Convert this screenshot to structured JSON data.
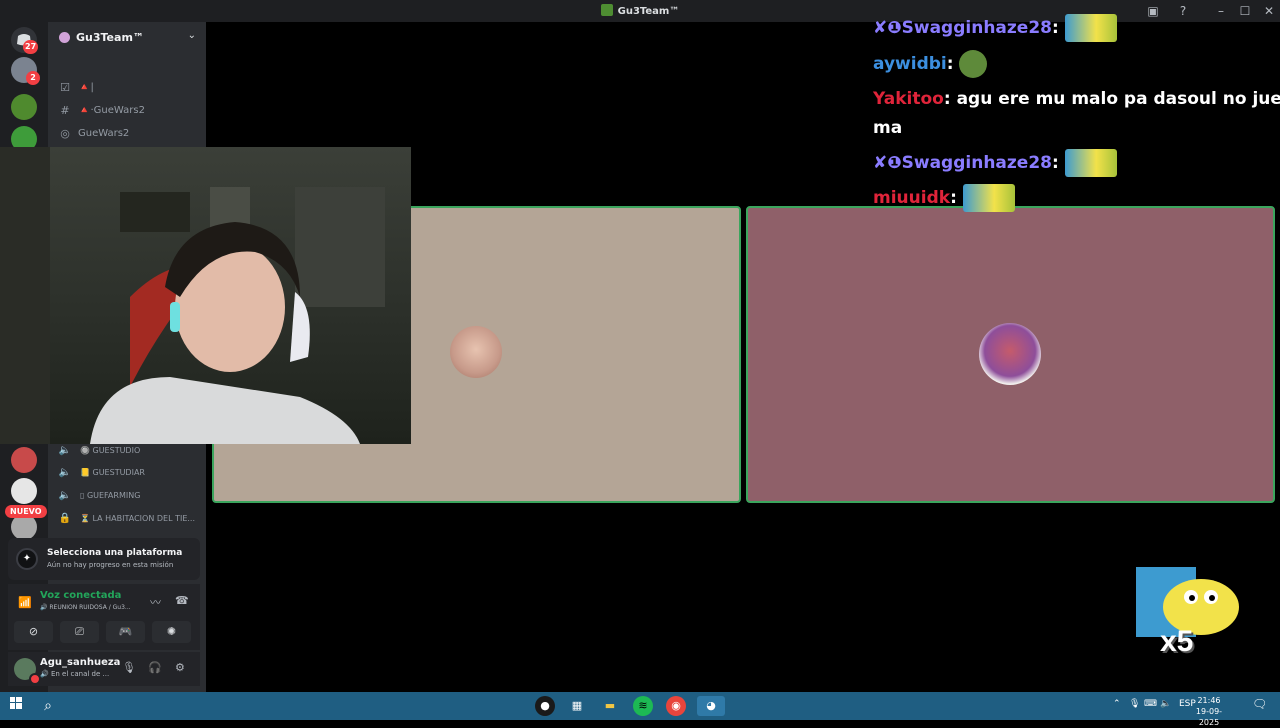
{
  "window": {
    "title": "Gu3Team™",
    "buttons": {
      "minimize": "–",
      "maximize": "☐",
      "close": "✕"
    }
  },
  "server_rail": {
    "badges": {
      "home": "27",
      "dm1": "2"
    },
    "new_label": "NUEVO"
  },
  "sidebar": {
    "server_name": "Gu3Team™",
    "channels": [
      {
        "icon": "checkbox-icon",
        "label": "🔺|"
      },
      {
        "icon": "hash-icon",
        "label": "🔺·GueWars2"
      },
      {
        "icon": "stage-icon",
        "label": "GueWars2"
      }
    ],
    "voice_channels": [
      {
        "icon": "speaker-icon",
        "label": "🔘 GUESTUDIO"
      },
      {
        "icon": "speaker-icon",
        "label": "📒 GUESTUDIAR"
      },
      {
        "icon": "speaker-icon",
        "label": "▯ GUEFARMING"
      },
      {
        "icon": "lock-icon",
        "label": "⏳ LA HABITACION DEL TIE..."
      }
    ]
  },
  "quest": {
    "title": "Selecciona una plataforma",
    "subtitle": "Aún no hay progreso en esta misión"
  },
  "voice": {
    "status": "Voz conectada",
    "detail": "🔊 REUNION RUIDOSA / Gu3..."
  },
  "user": {
    "name": "Agu_sanhueza",
    "status": "🔊 En el canal de ..."
  },
  "chat": [
    {
      "user": "✘❶Swagginhaze28",
      "color": "#8a7cff",
      "text": ""
    },
    {
      "user": "aywidbi",
      "color": "#3c8fe0",
      "text": ""
    },
    {
      "user": "Yakitoo",
      "color": "#e0243a",
      "text": "agu ere mu malo pa dasoul no juege"
    },
    {
      "user": "",
      "color": "#ffffff",
      "text": "ma"
    },
    {
      "user": "✘❶Swagginhaze28",
      "color": "#8a7cff",
      "text": ""
    },
    {
      "user": "miuuidk",
      "color": "#e0243a",
      "text": ""
    }
  ],
  "overlay": {
    "multiplier": "x5"
  },
  "taskbar": {
    "lang": "ESP",
    "time": "21:46",
    "date": "19-09-2025"
  },
  "colors": {
    "tile_left": "#b4a596",
    "tile_right": "#8f6069",
    "tile_border": "#3ba55d",
    "taskbar": "#1f5e82"
  }
}
